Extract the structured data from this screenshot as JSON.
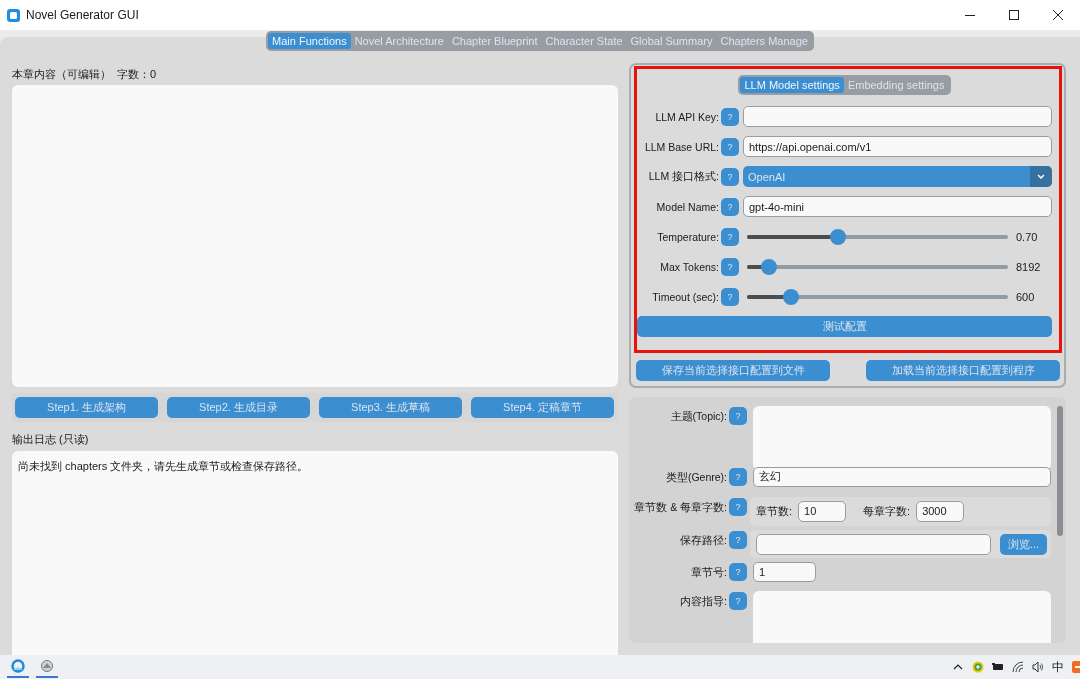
{
  "window": {
    "title": "Novel Generator GUI"
  },
  "tabs": [
    {
      "label": "Main Functions",
      "selected": true
    },
    {
      "label": "Novel Architecture",
      "selected": false
    },
    {
      "label": "Chapter Blueprint",
      "selected": false
    },
    {
      "label": "Character State",
      "selected": false
    },
    {
      "label": "Global Summary",
      "selected": false
    },
    {
      "label": "Chapters Manage",
      "selected": false
    }
  ],
  "chapter_editor": {
    "label": "本章内容（可编辑）  字数：0"
  },
  "steps": [
    "Step1. 生成架构",
    "Step2. 生成目录",
    "Step3. 生成草稿",
    "Step4. 定稿章节"
  ],
  "log": {
    "label": "输出日志 (只读)",
    "text": "尚未找到 chapters 文件夹，请先生成章节或检查保存路径。"
  },
  "config": {
    "tabs": [
      {
        "label": "LLM Model settings",
        "selected": true
      },
      {
        "label": "Embedding settings",
        "selected": false
      }
    ],
    "rows": [
      {
        "kind": "text",
        "label": "LLM API Key:",
        "help": "?"
      },
      {
        "kind": "text",
        "label": "LLM Base URL:",
        "help": "?",
        "value": "https://api.openai.com/v1"
      },
      {
        "kind": "dropdown",
        "label": "LLM 接口格式:",
        "help": "?",
        "value": "OpenAI"
      },
      {
        "kind": "text",
        "label": "Model Name:",
        "help": "?",
        "value": "gpt-4o-mini"
      },
      {
        "kind": "slider",
        "label": "Temperature:",
        "help": "?",
        "level": 0.35,
        "reading": "0.70"
      },
      {
        "kind": "slider",
        "label": "Max Tokens:",
        "help": "?",
        "level": 0.085,
        "reading": "8192"
      },
      {
        "kind": "slider",
        "label": "Timeout (sec):",
        "help": "?",
        "level": 0.17,
        "reading": "600"
      }
    ],
    "test_button": "测试配置",
    "actions": [
      "保存当前选择接口配置到文件",
      "加载当前选择接口配置到程序"
    ]
  },
  "novel_params": {
    "rows": [
      {
        "kind": "textarea",
        "label": "主题(Topic):",
        "help": "?"
      },
      {
        "kind": "text",
        "label": "类型(Genre):",
        "help": "?",
        "value": "玄幻"
      },
      {
        "kind": "pair",
        "label": "章节数 & 每章字数:",
        "help": "?",
        "fields": [
          {
            "label": "章节数:",
            "value": "10"
          },
          {
            "label": "每章字数:",
            "value": "3000"
          }
        ]
      },
      {
        "kind": "path",
        "label": "保存路径:",
        "help": "?",
        "button": "浏览..."
      },
      {
        "kind": "short",
        "label": "章节号:",
        "help": "?",
        "value": "1"
      },
      {
        "kind": "textarea",
        "label": "内容指导:",
        "help": "?"
      }
    ]
  },
  "taskbar": {
    "input_method": "中"
  }
}
